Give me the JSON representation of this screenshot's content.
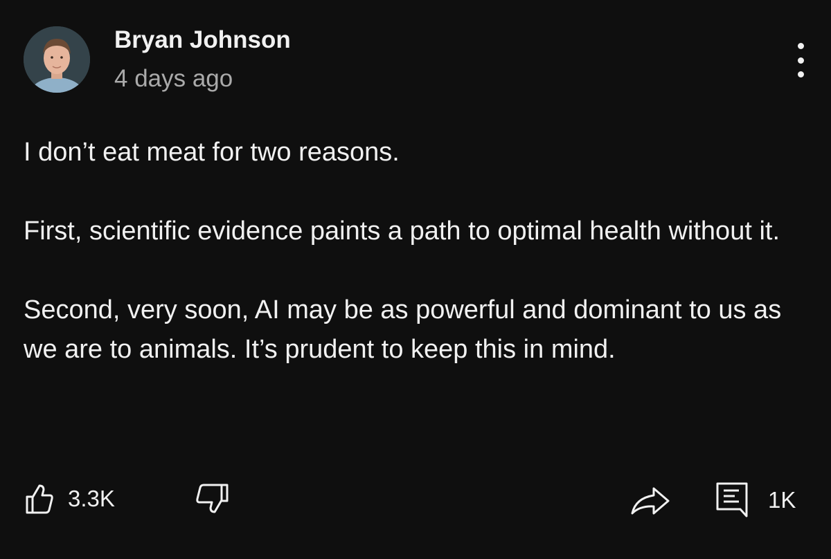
{
  "author": {
    "name": "Bryan Johnson",
    "posted": "4 days ago"
  },
  "post": {
    "paragraphs": [
      "I don’t eat meat for two reasons.",
      "First, scientific evidence paints a path to optimal health without it.",
      "Second, very soon, AI may be as powerful and dominant to us as we are to animals. It’s prudent to keep this in mind."
    ]
  },
  "actions": {
    "likes": "3.3K",
    "comments": "1K"
  },
  "icons": {
    "menu": "more-vertical-icon",
    "like": "thumbs-up-icon",
    "dislike": "thumbs-down-icon",
    "share": "share-icon",
    "comment": "comment-icon"
  },
  "colors": {
    "background": "#0f0f0f",
    "text": "#f1f1f1",
    "secondary_text": "#aaaaaa"
  }
}
